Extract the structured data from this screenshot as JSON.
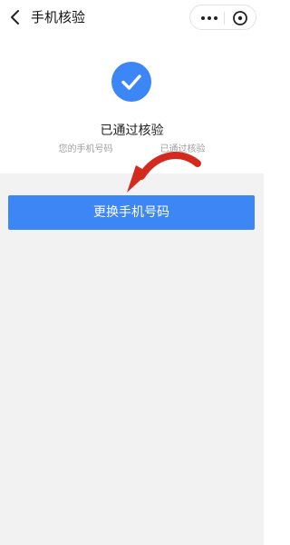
{
  "header": {
    "title": "手机核验"
  },
  "verification": {
    "status_title": "已通过核验",
    "desc_prefix": "您的手机号码",
    "desc_suffix": "已通过核验"
  },
  "actions": {
    "change_phone_label": "更换手机号码"
  },
  "colors": {
    "accent": "#3d86f5",
    "annotation_arrow": "#d42a1d",
    "background": "#f2f2f2"
  },
  "icons": {
    "back": "chevron-left-icon",
    "more": "more-dots-icon",
    "close": "close-circle-icon",
    "success": "check-icon",
    "annotation": "curved-arrow-icon"
  }
}
